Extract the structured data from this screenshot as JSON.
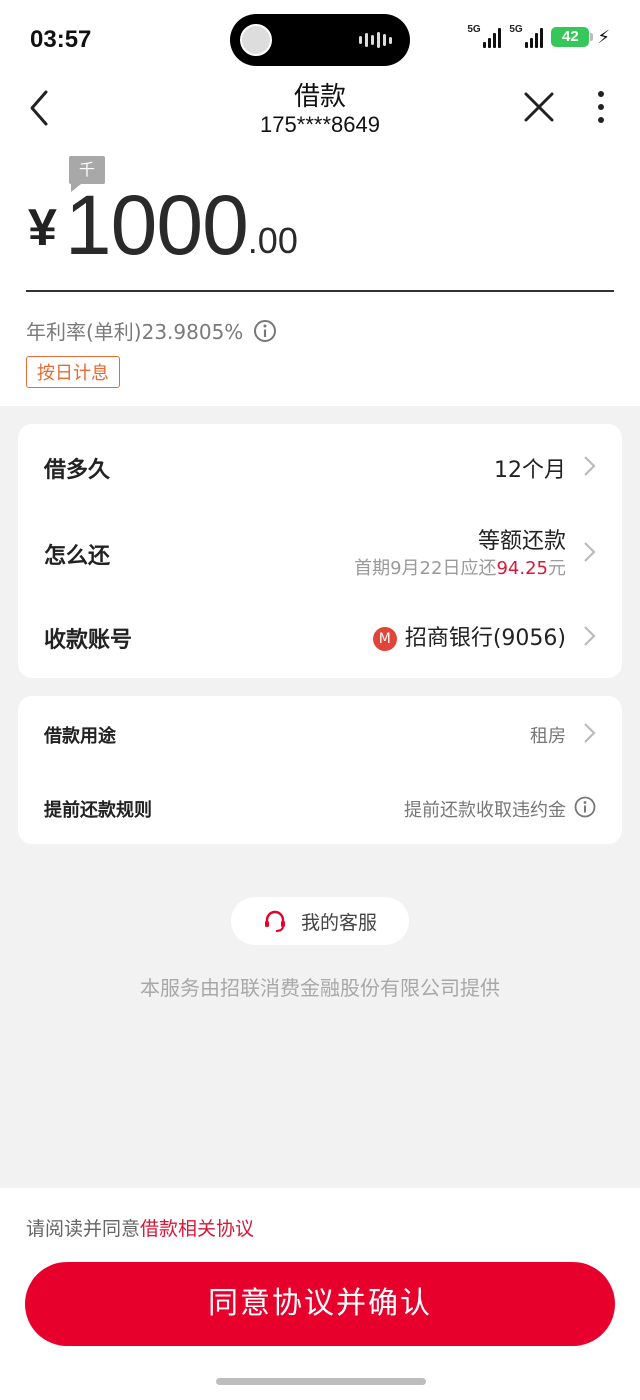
{
  "status_bar": {
    "time": "03:57",
    "signal1_label": "5G",
    "signal2_label": "5G",
    "battery": "42",
    "charging_icon": "bolt-icon"
  },
  "nav": {
    "title": "借款",
    "subtitle": "175****8649",
    "back_icon": "chevron-left-icon",
    "close_icon": "close-icon",
    "more_icon": "more-vertical-icon"
  },
  "amount": {
    "unit_badge": "千",
    "currency": "¥",
    "integer": "1000",
    "decimal": ".00"
  },
  "rate": {
    "text": "年利率(单利)23.9805%"
  },
  "tag": "按日计息",
  "loan_card": {
    "term_label": "借多久",
    "term_value": "12个月",
    "repay_label": "怎么还",
    "repay_value": "等额还款",
    "repay_note_prefix": "首期9月22日应还",
    "repay_note_amount": "94.25",
    "repay_note_suffix": "元",
    "account_label": "收款账号",
    "bank_logo": "M",
    "account_value": "招商银行(9056)"
  },
  "purpose_card": {
    "purpose_label": "借款用途",
    "purpose_value": "租房",
    "rule_label": "提前还款规则",
    "rule_value": "提前还款收取违约金"
  },
  "service": {
    "label": "我的客服",
    "provider": "本服务由招联消费金融股份有限公司提供"
  },
  "footer": {
    "agree_prefix": "请阅读并同意",
    "agree_link": "借款相关协议",
    "confirm_label": "同意协议并确认"
  },
  "colors": {
    "accent": "#e8002d",
    "link": "#d6183a",
    "tag": "#e86a34"
  }
}
